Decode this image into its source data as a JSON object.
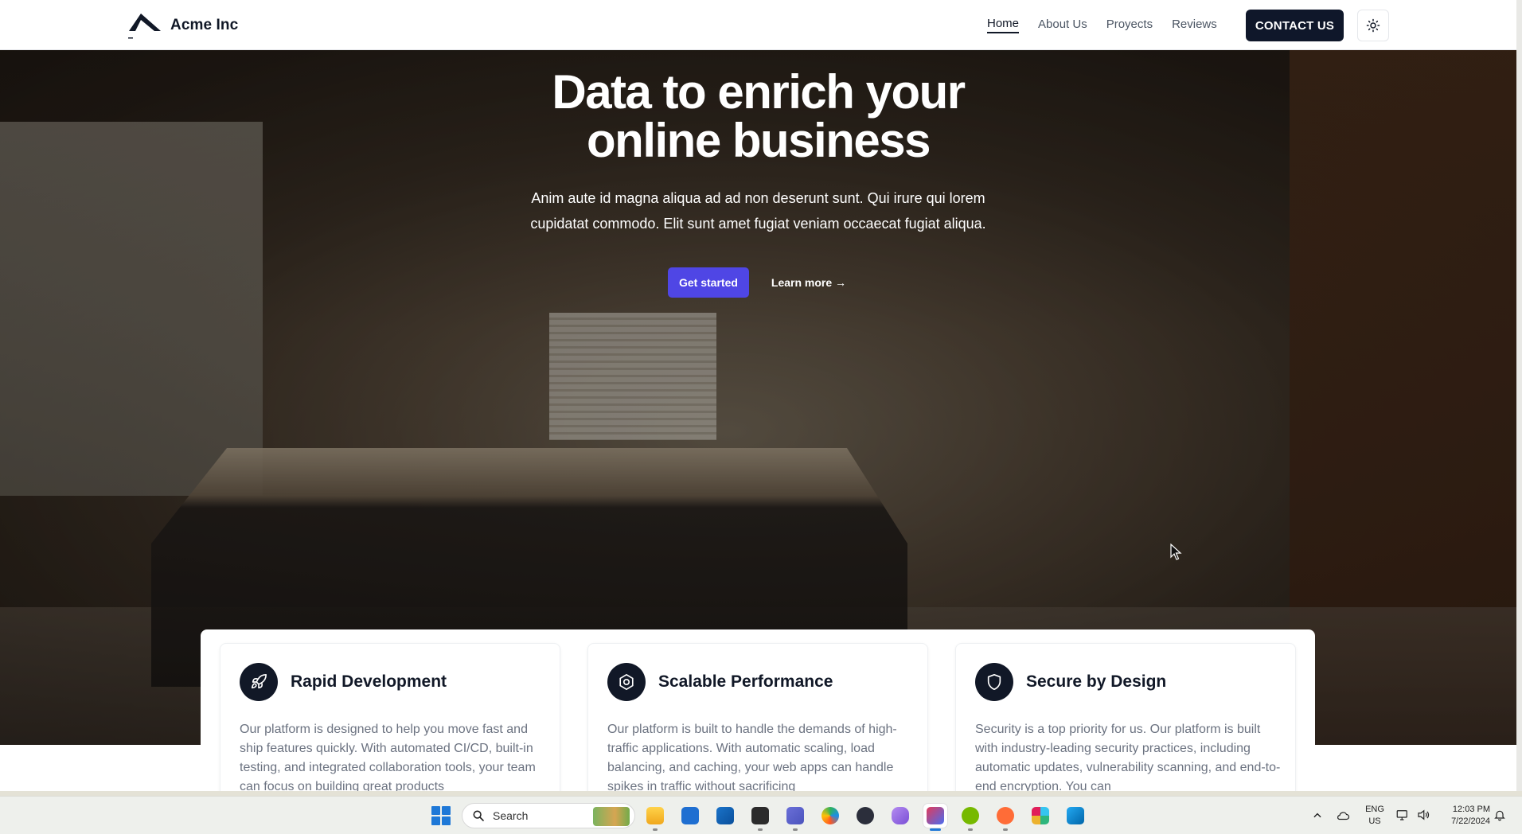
{
  "nav": {
    "brand": "Acme Inc",
    "links": [
      {
        "label": "Home",
        "active": true
      },
      {
        "label": "About Us",
        "active": false
      },
      {
        "label": "Proyects",
        "active": false
      },
      {
        "label": "Reviews",
        "active": false
      }
    ],
    "contact_label": "CONTACT US",
    "theme_icon": "sun-icon"
  },
  "hero": {
    "title_line1": "Data to enrich your",
    "title_line2": "online business",
    "subtitle": "Anim aute id magna aliqua ad ad non deserunt sunt. Qui irure qui lorem cupidatat commodo. Elit sunt amet fugiat veniam occaecat fugiat aliqua.",
    "primary_cta": "Get started",
    "secondary_cta": "Learn more →"
  },
  "features": [
    {
      "icon": "rocket-icon",
      "title": "Rapid Development",
      "text": "Our platform is designed to help you move fast and ship features quickly. With automated CI/CD, built-in testing, and integrated collaboration tools, your team can focus on building great products"
    },
    {
      "icon": "hexagon-icon",
      "title": "Scalable Performance",
      "text": "Our platform is built to handle the demands of high-traffic applications. With automatic scaling, load balancing, and caching, your web apps can handle spikes in traffic without sacrificing"
    },
    {
      "icon": "shield-icon",
      "title": "Secure by Design",
      "text": "Security is a top priority for us. Our platform is built with industry-leading security practices, including automatic updates, vulnerability scanning, and end-to-end encryption. You can"
    }
  ],
  "taskbar": {
    "search_placeholder": "Search",
    "apps": [
      "file-explorer-icon",
      "store-icon",
      "outlook-icon",
      "terminal-icon",
      "teams-icon",
      "edge-icon",
      "obs-icon",
      "copilot-icon",
      "app-active-icon",
      "nvidia-icon",
      "postman-icon",
      "slack-icon",
      "vscode-icon"
    ],
    "lang_line1": "ENG",
    "lang_line2": "US",
    "time": "12:03 PM",
    "date": "7/22/2024"
  },
  "colors": {
    "accent": "#4f46e5",
    "nav_dark": "#0f172a",
    "text_muted": "#6b7280"
  }
}
